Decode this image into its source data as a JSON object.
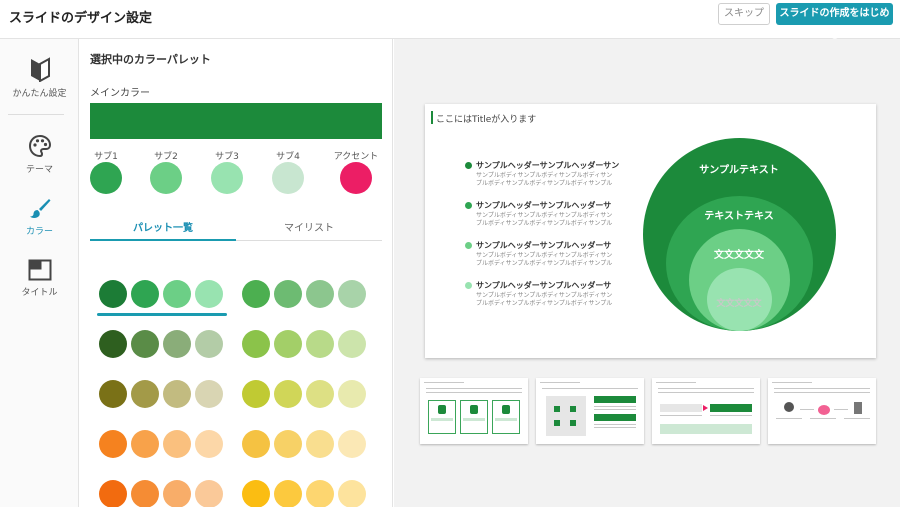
{
  "header": {
    "title": "スライドのデザイン設定",
    "skip_label": "スキップ",
    "start_label": "スライドの作成をはじめる"
  },
  "sidenav": {
    "items": [
      {
        "label": "かんたん設定",
        "icon": "beginner-leaf-icon",
        "active": false
      },
      {
        "label": "テーマ",
        "icon": "palette-icon",
        "active": false
      },
      {
        "label": "カラー",
        "icon": "paintbrush-icon",
        "active": true
      },
      {
        "label": "タイトル",
        "icon": "title-layout-icon",
        "active": false
      }
    ]
  },
  "panel": {
    "title": "選択中のカラーパレット",
    "main_label": "メインカラー",
    "main_color": "#1c8a3b",
    "subs": [
      {
        "label": "サブ1",
        "color": "#2fa552"
      },
      {
        "label": "サブ2",
        "color": "#6ccf86"
      },
      {
        "label": "サブ3",
        "color": "#98e3b0"
      },
      {
        "label": "サブ4",
        "color": "#c8e6d0"
      },
      {
        "label": "アクセント",
        "color": "#ec1e65"
      }
    ],
    "tabs": [
      {
        "label": "パレット一覧",
        "active": true
      },
      {
        "label": "マイリスト",
        "active": false
      }
    ],
    "palettes": [
      [
        "#1c7c36",
        "#2fa552",
        "#6ccf86",
        "#98e3b0"
      ],
      [
        "#4caf50",
        "#6dbb72",
        "#8cc68e",
        "#a8d3a9"
      ],
      [
        "#2e5f1f",
        "#5a8c47",
        "#8aad79",
        "#b3cca7"
      ],
      [
        "#8bc34a",
        "#a3cf68",
        "#b8da89",
        "#cce4ab"
      ],
      [
        "#7a7117",
        "#a39a48",
        "#c2bb80",
        "#d9d5b3"
      ],
      [
        "#c0ca33",
        "#d0d658",
        "#dde084",
        "#e8eaae"
      ],
      [
        "#f5821f",
        "#f8a24a",
        "#fac07e",
        "#fcd7a8"
      ],
      [
        "#f5c242",
        "#f7d166",
        "#f9de8f",
        "#fbe8b5"
      ],
      [
        "#f26b0f",
        "#f58c34",
        "#f8ad69",
        "#fac999"
      ],
      [
        "#fbbd12",
        "#fcc93e",
        "#fdd670",
        "#fde39d"
      ]
    ]
  },
  "slide": {
    "title": "ここにはTitleが入ります",
    "bullets": [
      {
        "head": "サンプルヘッダーサンプルヘッダーサン",
        "body1": "サンプルボディサンプルボディサンプルボディサン",
        "body2": "プルボディサンプルボディサンプルボディサンプル",
        "color": "#1c8a3b"
      },
      {
        "head": "サンプルヘッダーサンプルヘッダーサ",
        "body1": "サンプルボディサンプルボディサンプルボディサン",
        "body2": "プルボディサンプルボディサンプルボディサンプル",
        "color": "#2fa552"
      },
      {
        "head": "サンプルヘッダーサンプルヘッダーサ",
        "body1": "サンプルボディサンプルボディサンプルボディサン",
        "body2": "プルボディサンプルボディサンプルボディサンプル",
        "color": "#6ccf86"
      },
      {
        "head": "サンプルヘッダーサンプルヘッダーサ",
        "body1": "サンプルボディサンプルボディサンプルボディサン",
        "body2": "プルボディサンプルボディサンプルボディサンプル",
        "color": "#98e3b0"
      }
    ],
    "circles": [
      "サンプルテキスト",
      "テキストテキス",
      "文文文文文",
      "文文文文文"
    ]
  }
}
